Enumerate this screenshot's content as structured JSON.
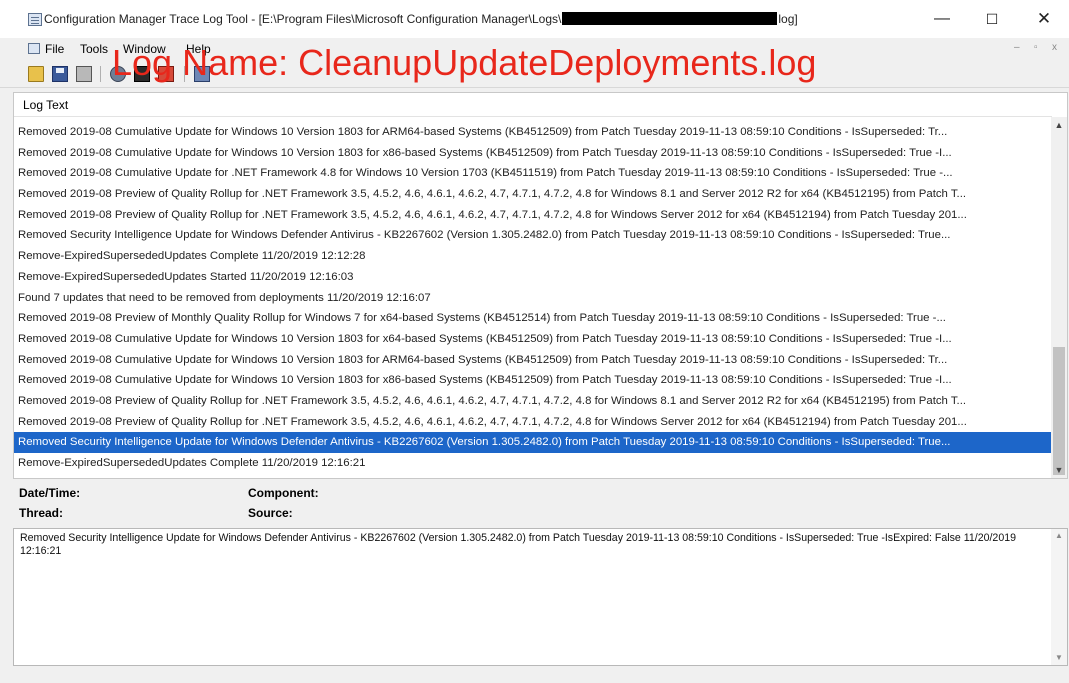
{
  "window": {
    "title_prefix": "Configuration Manager Trace Log Tool - [E:\\Program Files\\Microsoft Configuration Manager\\Logs\\",
    "title_suffix": "log]",
    "controls": {
      "minimize": "—",
      "maximize": "☐",
      "close": "✕"
    }
  },
  "menu": {
    "file": "File",
    "tools": "Tools",
    "window": "Window",
    "help": "Help",
    "mdi_controls": {
      "minimize": "–",
      "restore": "▫",
      "close": "x"
    }
  },
  "toolbar": {
    "icons": [
      "open-icon",
      "save-icon",
      "print-icon",
      "find-icon",
      "find-next-icon",
      "pause-icon",
      "highlight-icon"
    ]
  },
  "overlay": {
    "text": "Log Name: CleanupUpdateDeployments.log",
    "color": "#e8271b"
  },
  "log": {
    "column_header": "Log Text",
    "selected_index": 15,
    "selection_color": "#1d66c9",
    "rows": [
      "Removed 2019-08 Cumulative Update for Windows 10 Version 1803 for ARM64-based Systems (KB4512509) from Patch Tuesday 2019-11-13 08:59:10 Conditions - IsSuperseded: Tr...",
      "Removed 2019-08 Cumulative Update for Windows 10 Version 1803 for x86-based Systems (KB4512509) from Patch Tuesday 2019-11-13 08:59:10 Conditions - IsSuperseded: True -I...",
      "Removed 2019-08 Cumulative Update for .NET Framework 4.8 for Windows 10 Version 1703 (KB4511519) from Patch Tuesday 2019-11-13 08:59:10 Conditions - IsSuperseded: True -...",
      "Removed 2019-08 Preview of Quality Rollup for .NET Framework 3.5, 4.5.2, 4.6, 4.6.1, 4.6.2, 4.7, 4.7.1, 4.7.2, 4.8 for Windows 8.1 and Server 2012 R2 for x64 (KB4512195) from Patch T...",
      "Removed 2019-08 Preview of Quality Rollup for .NET Framework 3.5, 4.5.2, 4.6, 4.6.1, 4.6.2, 4.7, 4.7.1, 4.7.2, 4.8 for Windows Server 2012 for x64 (KB4512194) from Patch Tuesday 201...",
      "Removed Security Intelligence Update for Windows Defender Antivirus - KB2267602 (Version 1.305.2482.0) from Patch Tuesday 2019-11-13 08:59:10 Conditions - IsSuperseded: True...",
      "Remove-ExpiredSupersededUpdates Complete 11/20/2019 12:12:28",
      "Remove-ExpiredSupersededUpdates Started 11/20/2019 12:16:03",
      "Found 7 updates that need to be removed from deployments 11/20/2019 12:16:07",
      "Removed 2019-08 Preview of Monthly Quality Rollup for Windows 7 for x64-based Systems (KB4512514) from Patch Tuesday 2019-11-13 08:59:10 Conditions - IsSuperseded: True -...",
      "Removed 2019-08 Cumulative Update for Windows 10 Version 1803 for x64-based Systems (KB4512509) from Patch Tuesday 2019-11-13 08:59:10 Conditions - IsSuperseded: True -I...",
      "Removed 2019-08 Cumulative Update for Windows 10 Version 1803 for ARM64-based Systems (KB4512509) from Patch Tuesday 2019-11-13 08:59:10 Conditions - IsSuperseded: Tr...",
      "Removed 2019-08 Cumulative Update for Windows 10 Version 1803 for x86-based Systems (KB4512509) from Patch Tuesday 2019-11-13 08:59:10 Conditions - IsSuperseded: True -I...",
      "Removed 2019-08 Preview of Quality Rollup for .NET Framework 3.5, 4.5.2, 4.6, 4.6.1, 4.6.2, 4.7, 4.7.1, 4.7.2, 4.8 for Windows 8.1 and Server 2012 R2 for x64 (KB4512195) from Patch T...",
      "Removed 2019-08 Preview of Quality Rollup for .NET Framework 3.5, 4.5.2, 4.6, 4.6.1, 4.6.2, 4.7, 4.7.1, 4.7.2, 4.8 for Windows Server 2012 for x64 (KB4512194) from Patch Tuesday 201...",
      "Removed Security Intelligence Update for Windows Defender Antivirus - KB2267602 (Version 1.305.2482.0) from Patch Tuesday 2019-11-13 08:59:10 Conditions - IsSuperseded: True...",
      "Remove-ExpiredSupersededUpdates Complete 11/20/2019 12:16:21"
    ]
  },
  "details": {
    "date_label": "Date/Time:",
    "thread_label": "Thread:",
    "component_label": "Component:",
    "source_label": "Source:",
    "message": "Removed Security Intelligence Update for Windows Defender Antivirus - KB2267602 (Version 1.305.2482.0) from Patch Tuesday 2019-11-13 08:59:10 Conditions - IsSuperseded: True -IsExpired: False 11/20/2019 12:16:21"
  }
}
